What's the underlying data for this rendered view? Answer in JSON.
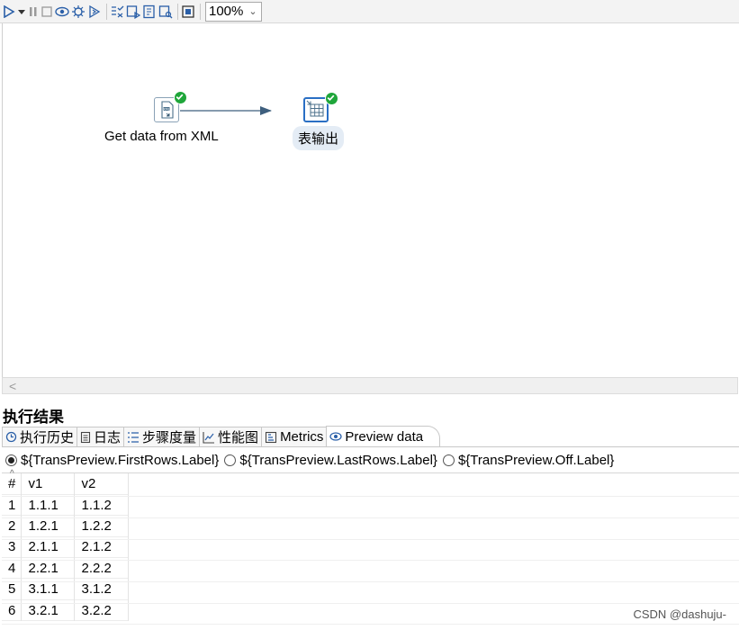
{
  "toolbar": {
    "zoom": "100%",
    "buttons": [
      "run-icon",
      "run-options-icon",
      "pause-icon",
      "stop-icon",
      "preview-icon",
      "debug-icon",
      "replay-icon",
      "verify-icon",
      "impact-icon",
      "sql-icon",
      "explore-db-icon",
      "layout-icon"
    ]
  },
  "canvas": {
    "steps": [
      {
        "label": "Get data from XML",
        "icon": "xml-input-icon",
        "status": "ok"
      },
      {
        "label": "表输出",
        "icon": "table-output-icon",
        "status": "ok"
      }
    ],
    "scroll_arrow": "<"
  },
  "results": {
    "title": "执行结果",
    "tabs": [
      {
        "label": "执行历史",
        "icon": "history-icon"
      },
      {
        "label": "日志",
        "icon": "log-icon"
      },
      {
        "label": "步骤度量",
        "icon": "step-metrics-icon"
      },
      {
        "label": "性能图",
        "icon": "performance-chart-icon"
      },
      {
        "label": "Metrics",
        "icon": "metrics-icon"
      },
      {
        "label": "Preview data",
        "icon": "eye-icon",
        "active": true
      }
    ],
    "radios": [
      {
        "label": "${TransPreview.FirstRows.Label}",
        "checked": true
      },
      {
        "label": "${TransPreview.LastRows.Label}",
        "checked": false
      },
      {
        "label": "${TransPreview.Off.Label}",
        "checked": false
      }
    ],
    "table": {
      "headers": [
        "#",
        "v1",
        "v2"
      ],
      "rows": [
        [
          "1",
          "1.1.1",
          "1.1.2"
        ],
        [
          "2",
          "1.2.1",
          "1.2.2"
        ],
        [
          "3",
          "2.1.1",
          "2.1.2"
        ],
        [
          "4",
          "2.2.1",
          "2.2.2"
        ],
        [
          "5",
          "3.1.1",
          "3.1.2"
        ],
        [
          "6",
          "3.2.1",
          "3.2.2"
        ]
      ]
    }
  },
  "watermark": "CSDN @dashuju-"
}
